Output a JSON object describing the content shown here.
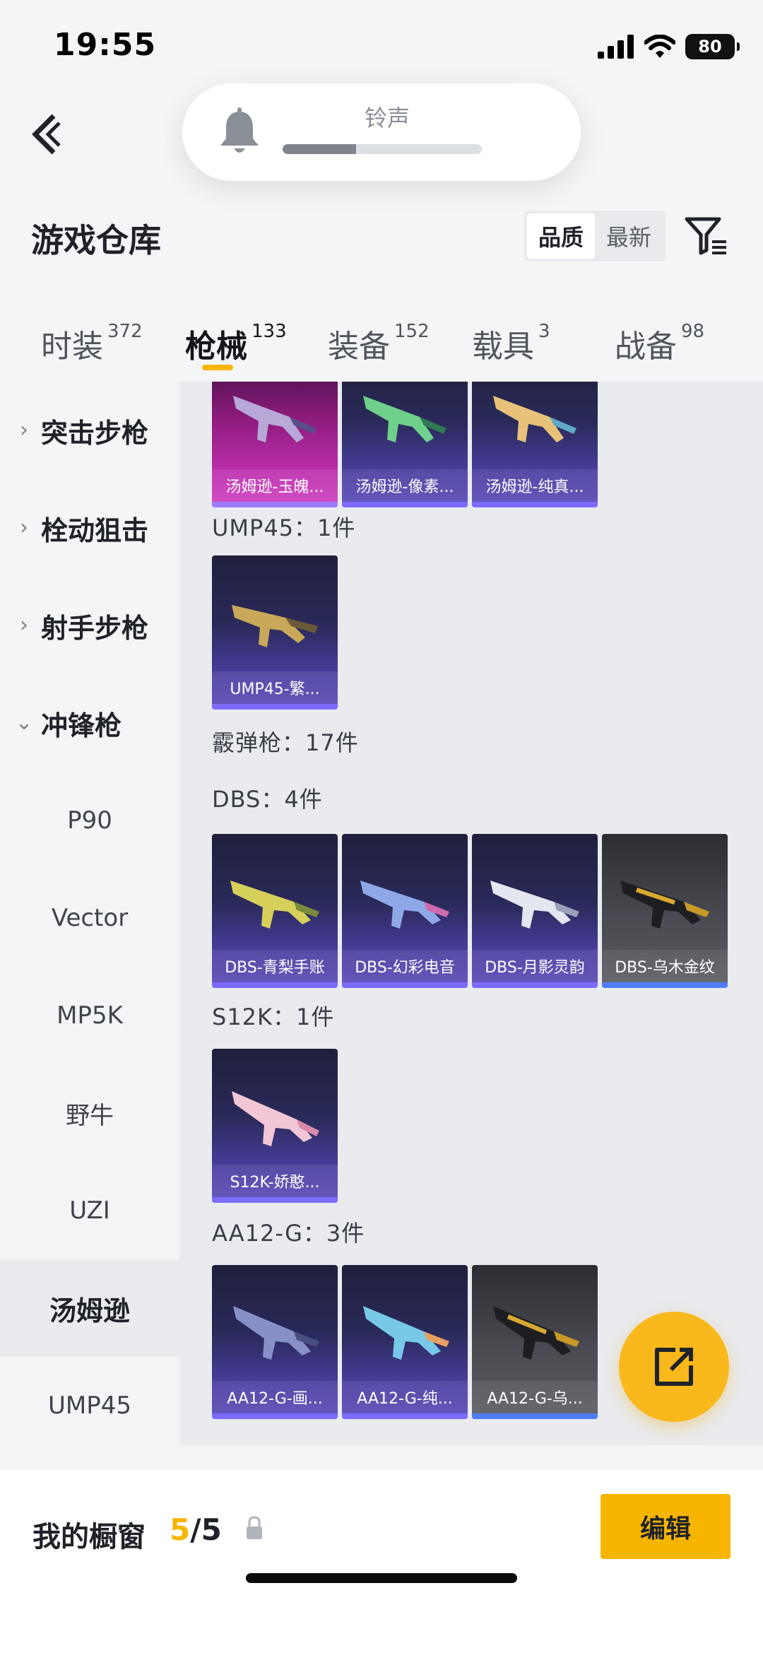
{
  "status_bar": {
    "time": "19:55",
    "battery": "80"
  },
  "volume_hud": {
    "label": "铃声",
    "level": 0.37
  },
  "header": {
    "title": "游戏仓库"
  },
  "sort": {
    "options": [
      "品质",
      "最新"
    ],
    "active": "品质"
  },
  "tabs": [
    {
      "label": "时装",
      "count": "372"
    },
    {
      "label": "枪械",
      "count": "133"
    },
    {
      "label": "装备",
      "count": "152"
    },
    {
      "label": "载具",
      "count": "3"
    },
    {
      "label": "战备",
      "count": "98"
    }
  ],
  "sidebar": {
    "categories": [
      {
        "label": "突击步枪",
        "arrow": "›"
      },
      {
        "label": "栓动狙击",
        "arrow": "›"
      },
      {
        "label": "射手步枪",
        "arrow": "›"
      },
      {
        "label": "冲锋枪",
        "arrow": "⌄"
      }
    ],
    "subitems": [
      "P90",
      "Vector",
      "MP5K",
      "野牛",
      "UZI",
      "汤姆逊",
      "UMP45"
    ],
    "active_subitem": "汤姆逊"
  },
  "content": {
    "top_row": [
      {
        "label": "汤姆逊-玉魄...",
        "style": "pink"
      },
      {
        "label": "汤姆逊-像素...",
        "style": "purple"
      },
      {
        "label": "汤姆逊-纯真...",
        "style": "purple"
      }
    ],
    "ump45": {
      "title": "UMP45：1件",
      "items": [
        {
          "label": "UMP45-繁..."
        }
      ]
    },
    "shotgun_title": "霰弹枪：17件",
    "dbs": {
      "title": "DBS：4件",
      "items": [
        {
          "label": "DBS-青梨手账",
          "style": "purple"
        },
        {
          "label": "DBS-幻彩电音",
          "style": "purple"
        },
        {
          "label": "DBS-月影灵韵",
          "style": "purple"
        },
        {
          "label": "DBS-乌木金纹",
          "style": "gray"
        }
      ]
    },
    "s12k": {
      "title": "S12K：1件",
      "items": [
        {
          "label": "S12K-娇憨..."
        }
      ]
    },
    "aa12": {
      "title": "AA12-G：3件",
      "items": [
        {
          "label": "AA12-G-画...",
          "style": "purple"
        },
        {
          "label": "AA12-G-纯...",
          "style": "purple"
        },
        {
          "label": "AA12-G-乌...",
          "style": "gray"
        }
      ]
    }
  },
  "bottom_bar": {
    "showcase_label": "我的橱窗",
    "showcase_current": "5",
    "showcase_sep_total": "/5",
    "edit_label": "编辑"
  },
  "colors": {
    "accent": "#f8b500",
    "card_purple": "#4a3ea0",
    "card_pink": "#c030b0",
    "card_gray": "#4a4b52"
  }
}
